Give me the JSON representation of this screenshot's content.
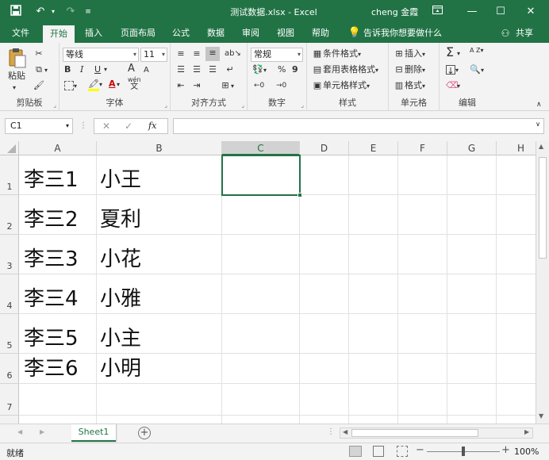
{
  "window": {
    "title": "测试数据.xlsx  -  Excel",
    "user": "cheng 金霞",
    "colors": {
      "brand": "#217346",
      "selection": "#217346"
    }
  },
  "tabs": [
    {
      "label": "文件"
    },
    {
      "label": "开始"
    },
    {
      "label": "插入"
    },
    {
      "label": "页面布局"
    },
    {
      "label": "公式"
    },
    {
      "label": "数据"
    },
    {
      "label": "审阅"
    },
    {
      "label": "视图"
    },
    {
      "label": "帮助"
    }
  ],
  "active_tab": "开始",
  "tellme": "告诉我你想要做什么",
  "share": "共享",
  "ribbon": {
    "clipboard": {
      "paste": "粘贴",
      "label": "剪贴板"
    },
    "font": {
      "name": "等线",
      "size": "11",
      "label": "字体",
      "bold": "B",
      "italic": "I",
      "underline": "U",
      "grow": "A",
      "shrink": "A",
      "color_a": "A",
      "wen": "wén",
      "wen_char": "文"
    },
    "alignment": {
      "label": "对齐方式"
    },
    "number": {
      "format": "常规",
      "label": "数字",
      "percent": "%",
      "comma": "9"
    },
    "styles": {
      "cond": "条件格式",
      "table": "套用表格格式",
      "cell": "单元格样式",
      "label": "样式"
    },
    "cells": {
      "insert": "插入",
      "delete": "删除",
      "format": "格式",
      "label": "单元格"
    },
    "editing": {
      "label": "编辑",
      "sigma": "Σ",
      "sort": "A Z"
    }
  },
  "formula_bar": {
    "name_box": "C1",
    "fx": "fx",
    "value": ""
  },
  "columns": [
    "A",
    "B",
    "C",
    "D",
    "E",
    "F",
    "G",
    "H"
  ],
  "rows": [
    {
      "num": "1",
      "a": "李三1",
      "b": "小王"
    },
    {
      "num": "2",
      "a": "李三2",
      "b": "夏利"
    },
    {
      "num": "3",
      "a": "李三3",
      "b": "小花"
    },
    {
      "num": "4",
      "a": "李三4",
      "b": "小雅"
    },
    {
      "num": "5",
      "a": "李三5",
      "b": "小主"
    },
    {
      "num": "6",
      "a": "李三6",
      "b": "小明"
    },
    {
      "num": "7",
      "a": "",
      "b": ""
    }
  ],
  "selected_cell": "C1",
  "sheet": {
    "name": "Sheet1"
  },
  "status": {
    "ready": "就绪",
    "zoom": "100%"
  }
}
